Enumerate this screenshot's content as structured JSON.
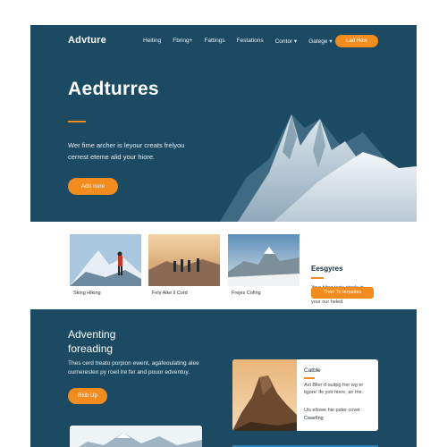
{
  "nav": {
    "logo": "Advture",
    "items": [
      "Heiting",
      "Fbring+",
      "Fattings",
      "Festations",
      "Contor",
      "Gatege"
    ],
    "carets": [
      "",
      "",
      "",
      "",
      " ▾",
      " ▾"
    ],
    "cta": "Lad Rew"
  },
  "hero": {
    "title": "Aedturres",
    "subtitle": "Wer fime archer is leyour creats frelyou cerrest eteme alid your hiore.",
    "button": "Add nure"
  },
  "cards": [
    {
      "caption": "Sking Hiking"
    },
    {
      "caption": "Fely Alke il Cord"
    },
    {
      "caption": "Frejes Cofing"
    }
  ],
  "side": {
    "title": "Eesgyres",
    "text": "Your hiing texis stools in love hegla. Thi ucp anve in your our heled.",
    "button": "Then To teryattes"
  },
  "lower": {
    "title_line1": "Adventing",
    "title_line2": "foreading",
    "text": "Thes cerd treato porpion ewent, agafeoulating alee ournereslen py roeil lre fer and pouor edventuy.",
    "button": "Rlob Up"
  },
  "card2": {
    "title": "Catble",
    "text": "Avt Bller d ouitpg frer wg er tigore' ife yoir hiere, an Ine.",
    "extra": "Uis ellowe hie pater covet",
    "link": "Cwarfing"
  },
  "colors": {
    "background": "#1c4a63",
    "accent": "#f28c1e",
    "card": "#ffffff"
  }
}
